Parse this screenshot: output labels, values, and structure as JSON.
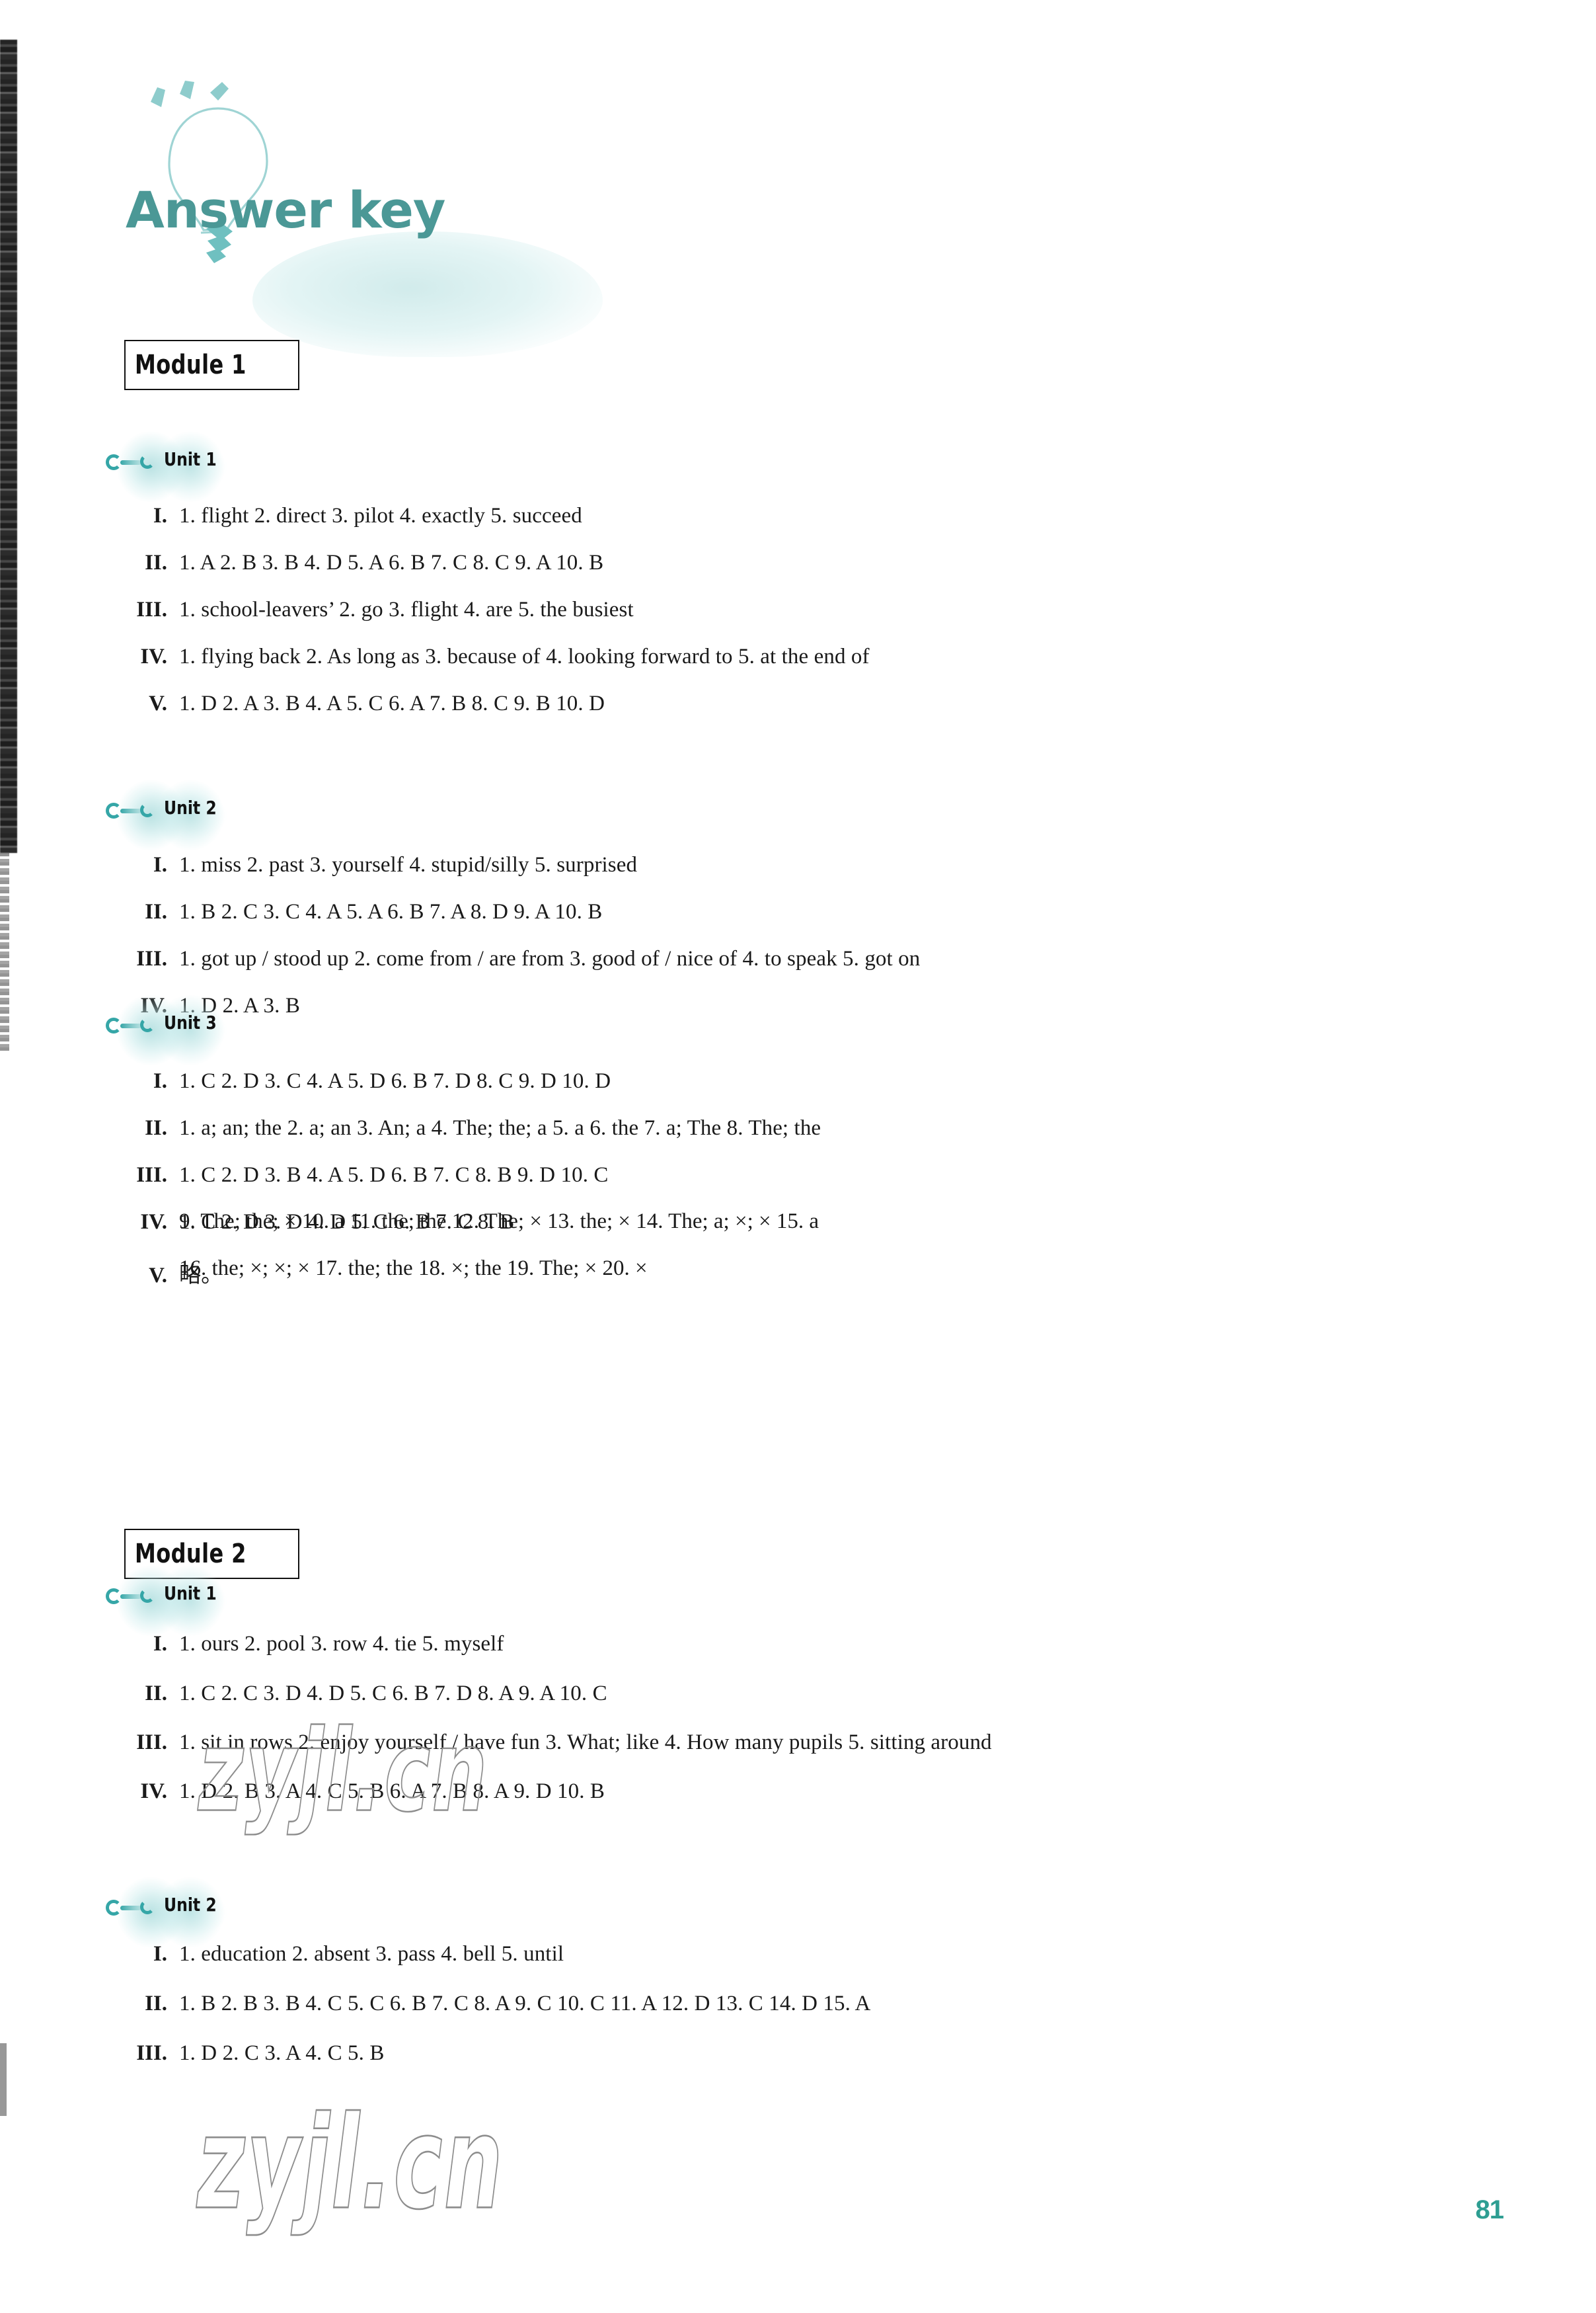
{
  "page": {
    "title": "Answer key",
    "number": "81",
    "watermark": "zyjl.cn",
    "accent_color": "#4b9896",
    "page_number_color": "#2e9e92",
    "icon": "lightbulb-icon"
  },
  "modules": [
    {
      "label": "Module 1",
      "units": [
        {
          "label": "Unit 1",
          "rows": [
            {
              "numeral": "I.",
              "answers": "1. flight   2. direct   3. pilot   4. exactly   5. succeed"
            },
            {
              "numeral": "II.",
              "answers": "1. A   2. B   3. B   4. D   5. A   6. B   7. C   8. C   9. A   10. B"
            },
            {
              "numeral": "III.",
              "answers": "1. school-leavers’   2. go   3. flight   4. are   5. the busiest"
            },
            {
              "numeral": "IV.",
              "answers": "1. flying back   2. As long as   3. because of   4. looking forward to   5. at the end of"
            },
            {
              "numeral": "V.",
              "answers": "1. D   2. A   3. B   4. A   5. C   6. A   7. B   8. C   9. B   10. D"
            }
          ]
        },
        {
          "label": "Unit 2",
          "rows": [
            {
              "numeral": "I.",
              "answers": "1. miss   2. past   3. yourself   4. stupid/silly   5. surprised"
            },
            {
              "numeral": "II.",
              "answers": "1. B   2. C   3. C   4. A   5. A   6. B   7. A   8. D   9. A   10. B"
            },
            {
              "numeral": "III.",
              "answers": "1. got up / stood up   2. come from / are from   3. good of / nice of   4. to speak   5. got on"
            },
            {
              "numeral": "IV.",
              "answers": "1. D   2. A   3. B"
            }
          ]
        },
        {
          "label": "Unit 3",
          "rows": [
            {
              "numeral": "I.",
              "answers": "1. C   2. D   3. C   4. A   5. D   6. B   7. D   8. C   9. D   10. D"
            },
            {
              "numeral": "II.",
              "answers": "1. a; an; the   2. a; an   3. An; a   4. The; the; a   5. a   6. the   7. a; The   8. The; the",
              "continuations": [
                "9. The; the; ×   10. a   11. the; the   12. The; ×   13. the; ×   14. The; a; ×; ×   15. a",
                "16. the; ×; ×; ×   17. the; the   18. ×; the   19. The; ×   20. ×"
              ]
            },
            {
              "numeral": "III.",
              "answers": "1. C   2. D   3. B   4. A   5. D   6. B   7. C   8. B   9. D   10. C"
            },
            {
              "numeral": "IV.",
              "answers": "1. C   2. D   3. D   4. D   5. C   6. B   7. C   8. B"
            },
            {
              "numeral": "V.",
              "answers": "略。"
            }
          ]
        }
      ]
    },
    {
      "label": "Module 2",
      "units": [
        {
          "label": "Unit 1",
          "rows": [
            {
              "numeral": "I.",
              "answers": "1. ours   2. pool   3. row   4. tie   5. myself"
            },
            {
              "numeral": "II.",
              "answers": "1. C   2. C   3. D   4. D   5. C   6. B   7. D   8. A   9. A   10. C"
            },
            {
              "numeral": "III.",
              "answers": "1. sit in rows   2. enjoy yourself / have fun   3. What; like   4. How many pupils   5. sitting around"
            },
            {
              "numeral": "IV.",
              "answers": "1. D   2. B   3. A   4. C   5. B   6. A   7. B   8. A   9. D   10. B"
            }
          ]
        },
        {
          "label": "Unit 2",
          "rows": [
            {
              "numeral": "I.",
              "answers": "1. education   2. absent   3. pass   4. bell   5. until"
            },
            {
              "numeral": "II.",
              "answers": "1. B   2. B   3. B   4. C   5. C   6. B   7. C   8. A   9. C   10. C   11. A   12. D   13. C   14. D   15. A"
            },
            {
              "numeral": "III.",
              "answers": "1. D   2. C   3. A   4. C   5. B"
            }
          ]
        }
      ]
    }
  ],
  "layout": {
    "module_tops": [
      514,
      2312
    ],
    "module_widths": [
      265,
      265
    ],
    "module_height": 76,
    "unit_tops": [
      665,
      1192,
      1517,
      2380,
      2851
    ],
    "row_tops": [
      [
        762,
        833,
        904,
        975,
        1046
      ],
      [
        1290,
        1361,
        1432,
        1503
      ],
      [
        1617,
        1688,
        1759,
        1830,
        1901
      ],
      [
        2468,
        2543,
        2617,
        2691
      ],
      [
        2937,
        3012,
        3087
      ]
    ],
    "continuation_tops": [
      1829,
      1900
    ]
  }
}
